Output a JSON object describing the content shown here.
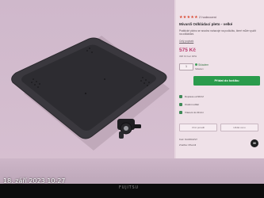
{
  "product": {
    "rating_stars": "★★★★★",
    "rating_text": "2 hodnocení",
    "title": "Mivardi Odkládací pleto - velké",
    "description": "Praktické plotno se snadno nahazuje na podložku, které může využít na odkládání.",
    "more_link": "Celý popisek",
    "price": "575 Kč",
    "price_vat": "338 Kč bez DPH",
    "qty": "1",
    "stock": "Skladem",
    "stock_sub": "Skladem",
    "add_button": "Přidat do košíku",
    "info_rows": [
      "Doprava od 99 Kč",
      "Osobní odběr",
      "Vrácení do 30 dní"
    ],
    "compare_buttons": [
      "Chci poradit",
      "Hlídat cenu"
    ],
    "meta": {
      "code_label": "Kód: M-MWAPLT",
      "brand_label": "Značka: Mivardi"
    }
  },
  "colors": {
    "price": "#b83a6e",
    "add_button": "#2a9b4c",
    "stars": "#d9462d"
  },
  "overlay": {
    "timestamp": "18. září 2023 10:27",
    "bezel_brand": "FUJITSU"
  }
}
